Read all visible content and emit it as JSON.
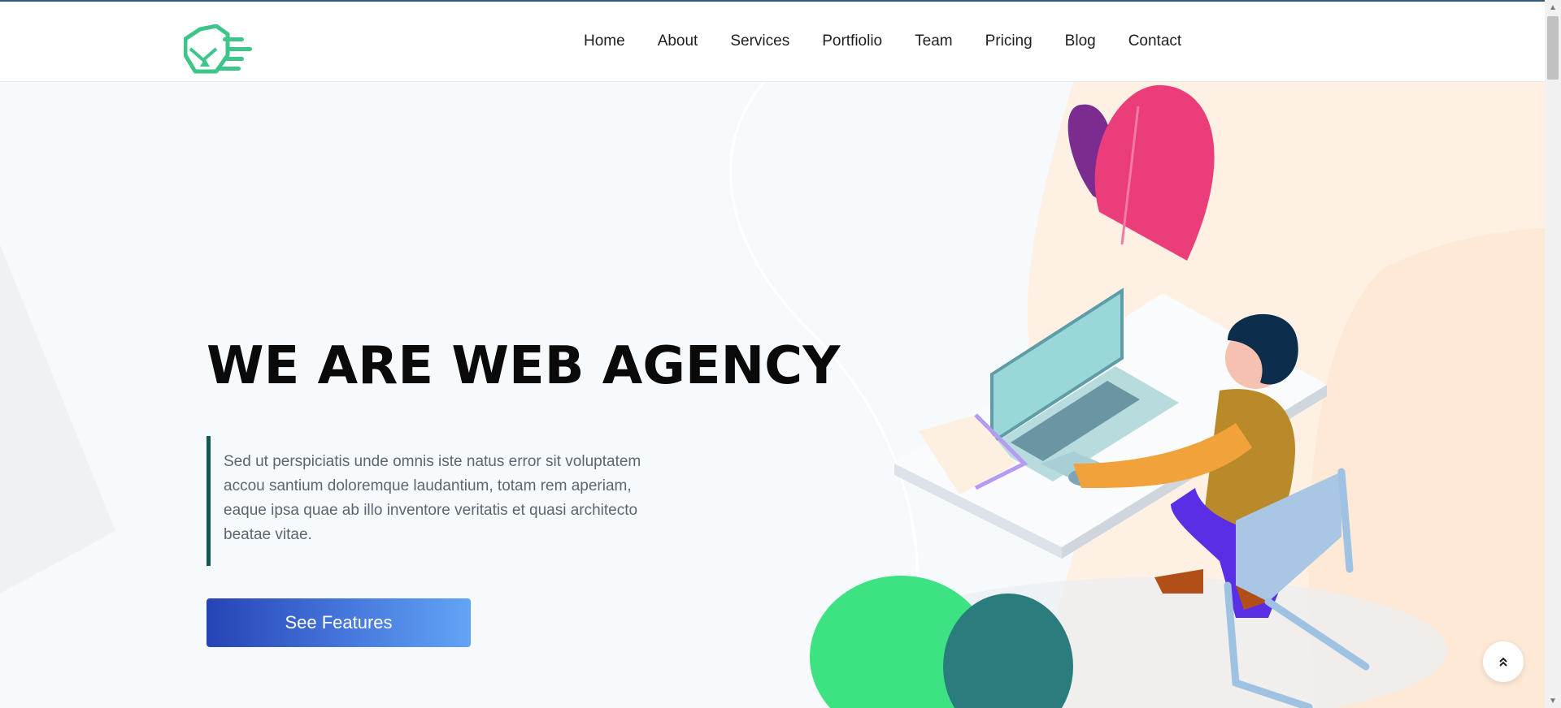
{
  "nav": {
    "items": [
      "Home",
      "About",
      "Services",
      "Portfiolio",
      "Team",
      "Pricing",
      "Blog",
      "Contact"
    ]
  },
  "hero": {
    "title": "WE ARE WEB AGENCY",
    "description": "Sed ut perspiciatis unde omnis iste natus error sit voluptatem accou santium doloremque laudantium, totam rem aperiam, eaque ipsa quae ab illo inventore veritatis et quasi architecto beatae vitae.",
    "cta_label": "See Features"
  },
  "icons": {
    "logo": "cube-logo-icon",
    "back_to_top": "double-chevron-up-icon",
    "illustration": "person-at-desk-illustration"
  },
  "colors": {
    "brand_green": "#3ec58a",
    "quote_border": "#0f5a55",
    "cta_gradient_start": "#2643b5",
    "cta_gradient_end": "#62a4f6",
    "title": "#0a0a0a",
    "body_text": "#5c6670"
  }
}
